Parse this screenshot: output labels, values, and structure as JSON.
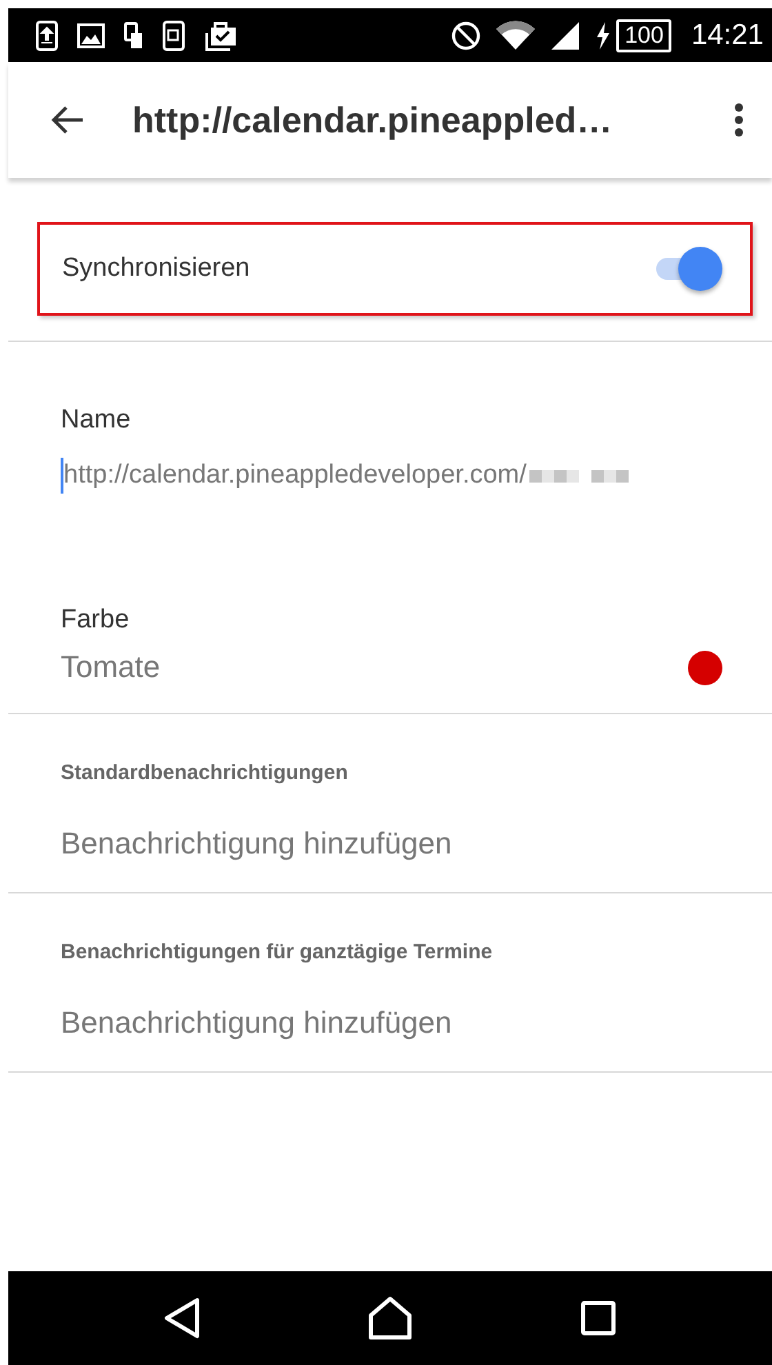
{
  "status_bar": {
    "battery": "100",
    "time": "14:21"
  },
  "toolbar": {
    "title": "http://calendar.pineappled…"
  },
  "sync": {
    "label": "Synchronisieren",
    "on": true,
    "highlighted": true
  },
  "name": {
    "label": "Name",
    "value": "http://calendar.pineappledeveloper.com/",
    "redacted": true
  },
  "color": {
    "label": "Farbe",
    "value": "Tomate",
    "color": "#d50000"
  },
  "sections": [
    {
      "header": "Standardbenachrichtigungen",
      "action": "Benachrichtigung hinzufügen"
    },
    {
      "header": "Benachrichtigungen für ganztägige Termine",
      "action": "Benachrichtigung hinzufügen"
    }
  ]
}
